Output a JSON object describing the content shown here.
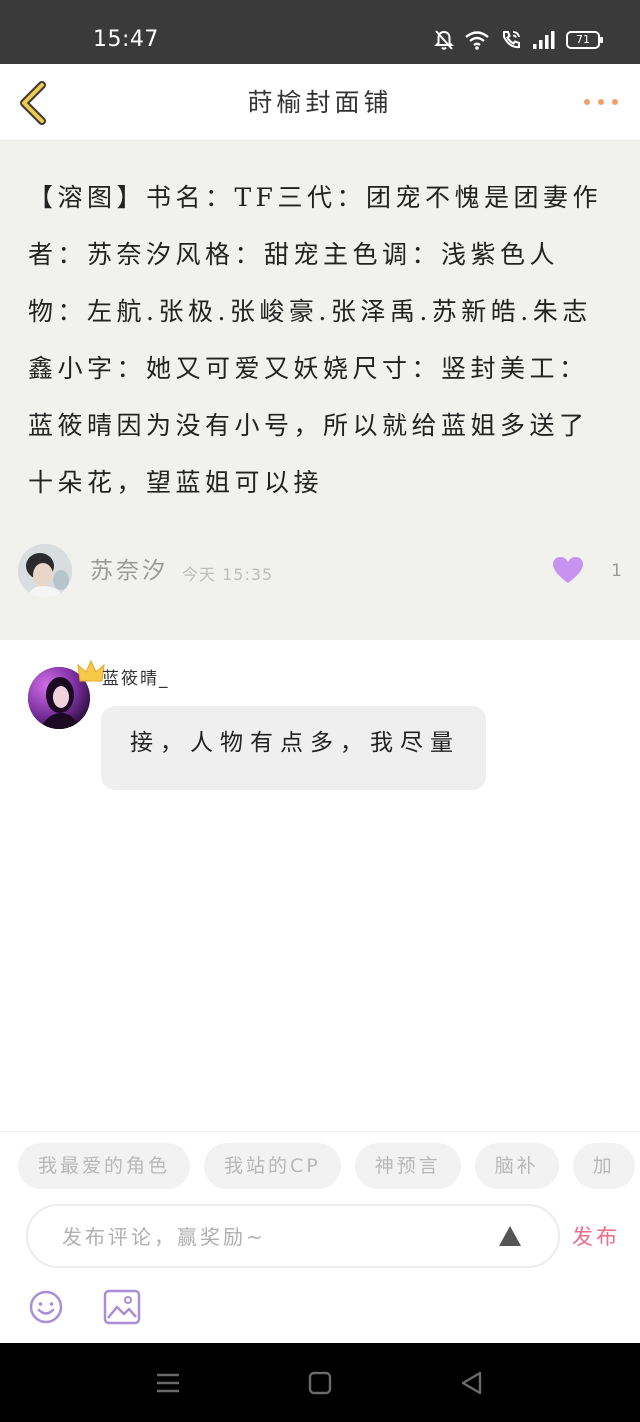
{
  "status_bar": {
    "time": "15:47",
    "battery": "71",
    "icons": [
      "mute-bell-icon",
      "wifi-icon",
      "wifi-call-icon",
      "signal-icon",
      "battery-icon"
    ]
  },
  "header": {
    "title": "莳榆封面铺",
    "back_icon": "chevron-left-icon",
    "more_icon": "more-dots-icon",
    "accent_color": "#f2c94c"
  },
  "post": {
    "content": "【溶图】书名：TF三代：团宠不愧是团妻作者：苏奈汐风格：甜宠主色调：浅紫色人物：左航.张极.张峻豪.张泽禹.苏新皓.朱志鑫小字：她又可爱又妖娆尺寸：竖封美工：蓝筱晴因为没有小号，所以就给蓝姐多送了十朵花，望蓝姐可以接",
    "author": "苏奈汐",
    "time": "今天 15:35",
    "likes": "1",
    "like_color": "#c792f0"
  },
  "comment": {
    "author": "蓝筱晴_",
    "text": "接，人物有点多，我尽量",
    "badge_icon": "crown-icon"
  },
  "composer": {
    "chips": [
      "我最爱的角色",
      "我站的CP",
      "神预言",
      "脑补",
      "加"
    ],
    "placeholder": "发布评论，赢奖励~",
    "publish_label": "发布",
    "publish_color": "#f06b8a"
  },
  "nav_bar": {
    "icons": [
      "menu-icon",
      "home-square-icon",
      "back-triangle-icon"
    ]
  }
}
